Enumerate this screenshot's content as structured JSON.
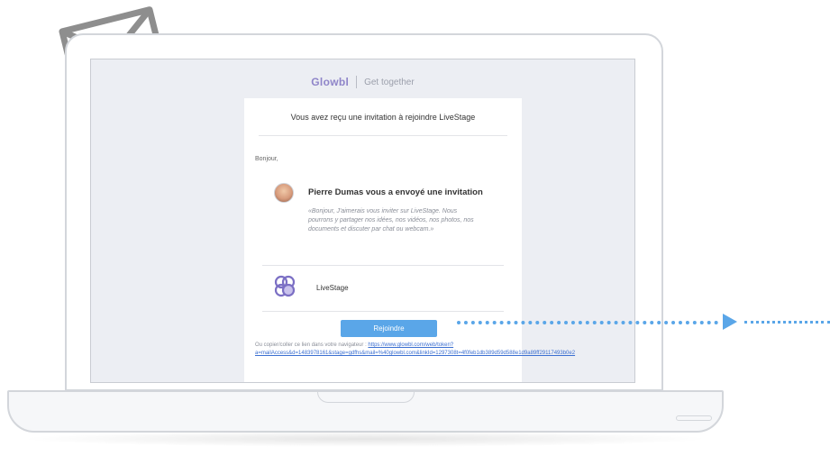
{
  "header": {
    "brand_logo": "Glowbl",
    "tagline": "Get together"
  },
  "email": {
    "subject": "Vous avez reçu une invitation à rejoindre LiveStage",
    "greeting": "Bonjour,",
    "sender_line": "Pierre Dumas vous a envoyé une invitation",
    "message": "«Bonjour, J'aimerais vous inviter sur LiveStage. Nous pourrons y partager nos idées, nos vidéos, nos photos, nos documents et discuter par chat ou webcam.»",
    "stage_name": "LiveStage",
    "join_label": "Rejoindre",
    "copy_prefix": "Ou copier/coller ce lien dans votre navigateur : ",
    "copy_link": "https://www.glowbl.com/web/token?a=mailAccess&d=1483978161&stage=gdfhs&mail=%40glowbl.com&linkId=1297308t=4f0feb1db389d59d588e1d9a89ff29117493b0e2"
  },
  "icons": {
    "envelope": "envelope-arrow-icon",
    "avatar": "user-avatar",
    "stage": "livestage-icon"
  },
  "colors": {
    "accent": "#5aa6e8",
    "brand": "#8f85c9",
    "link": "#3b6fd1"
  }
}
